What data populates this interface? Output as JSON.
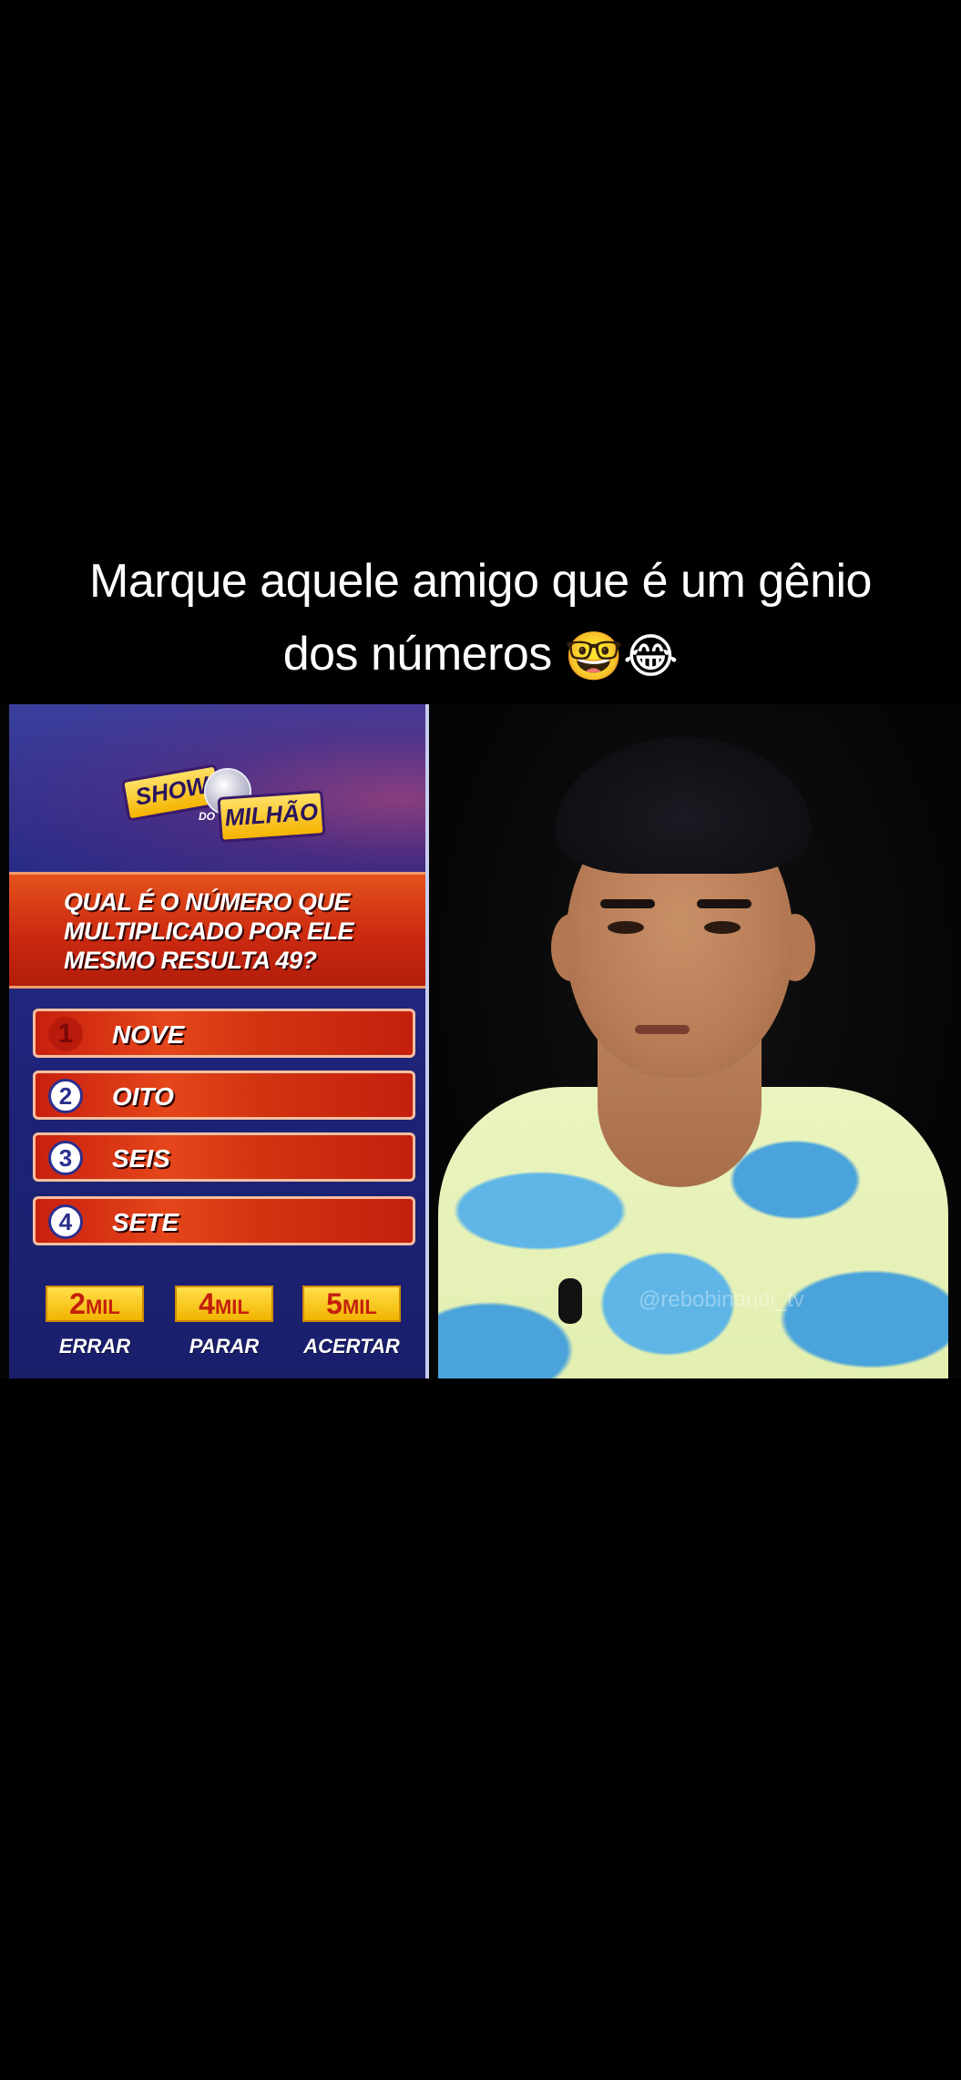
{
  "caption": {
    "line1": "Marque aquele amigo que é um gênio",
    "line2": "dos números",
    "emoji": "🤓😂"
  },
  "game": {
    "logo": {
      "top": "SHOW",
      "mini": "DO",
      "bottom": "MILHÃO"
    },
    "question": "QUAL É O NÚMERO QUE MULTIPLICADO POR ELE MESMO RESULTA 49?",
    "options": [
      {
        "number": "1",
        "label": "NOVE"
      },
      {
        "number": "2",
        "label": "OITO"
      },
      {
        "number": "3",
        "label": "SEIS"
      },
      {
        "number": "4",
        "label": "SETE"
      }
    ],
    "prizes": [
      {
        "value": "2",
        "unit": "MIL",
        "label": "ERRAR"
      },
      {
        "value": "4",
        "unit": "MIL",
        "label": "PARAR"
      },
      {
        "value": "5",
        "unit": "MIL",
        "label": "ACERTAR"
      }
    ]
  },
  "video": {
    "watermark": "@rebobinandi_tv"
  },
  "colors": {
    "background": "#000000",
    "panel": "#1e2378",
    "answer_red": "#d23310",
    "prize_yellow": "#f2b400"
  }
}
